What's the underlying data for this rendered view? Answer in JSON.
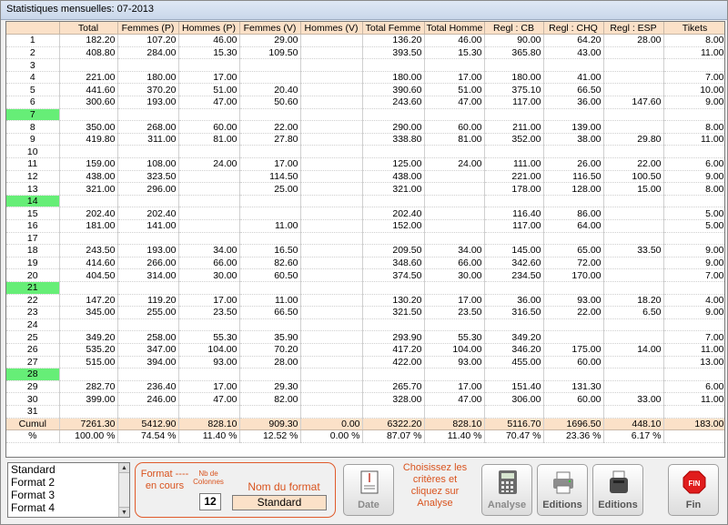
{
  "window": {
    "title": "Statistiques mensuelles: 07-2013"
  },
  "table": {
    "columns": [
      "",
      "Total",
      "Femmes (P)",
      "Hommes (P)",
      "Femmes (V)",
      "Hommes (V)",
      "Total Femme",
      "Total Homme",
      "Regl : CB",
      "Regl : CHQ",
      "Regl : ESP",
      "Tikets"
    ],
    "rows": [
      {
        "day": "1",
        "weekend": false,
        "cells": [
          "182.20",
          "107.20",
          "46.00",
          "29.00",
          "",
          "136.20",
          "46.00",
          "90.00",
          "64.20",
          "28.00",
          "8.00"
        ]
      },
      {
        "day": "2",
        "weekend": false,
        "cells": [
          "408.80",
          "284.00",
          "15.30",
          "109.50",
          "",
          "393.50",
          "15.30",
          "365.80",
          "43.00",
          "",
          "11.00"
        ]
      },
      {
        "day": "3",
        "weekend": false,
        "cells": [
          "",
          "",
          "",
          "",
          "",
          "",
          "",
          "",
          "",
          "",
          ""
        ]
      },
      {
        "day": "4",
        "weekend": false,
        "cells": [
          "221.00",
          "180.00",
          "17.00",
          "",
          "",
          "180.00",
          "17.00",
          "180.00",
          "41.00",
          "",
          "7.00"
        ]
      },
      {
        "day": "5",
        "weekend": false,
        "cells": [
          "441.60",
          "370.20",
          "51.00",
          "20.40",
          "",
          "390.60",
          "51.00",
          "375.10",
          "66.50",
          "",
          "10.00"
        ]
      },
      {
        "day": "6",
        "weekend": false,
        "cells": [
          "300.60",
          "193.00",
          "47.00",
          "50.60",
          "",
          "243.60",
          "47.00",
          "117.00",
          "36.00",
          "147.60",
          "9.00"
        ]
      },
      {
        "day": "7",
        "weekend": true,
        "cells": [
          "",
          "",
          "",
          "",
          "",
          "",
          "",
          "",
          "",
          "",
          ""
        ]
      },
      {
        "day": "8",
        "weekend": false,
        "cells": [
          "350.00",
          "268.00",
          "60.00",
          "22.00",
          "",
          "290.00",
          "60.00",
          "211.00",
          "139.00",
          "",
          "8.00"
        ]
      },
      {
        "day": "9",
        "weekend": false,
        "cells": [
          "419.80",
          "311.00",
          "81.00",
          "27.80",
          "",
          "338.80",
          "81.00",
          "352.00",
          "38.00",
          "29.80",
          "11.00"
        ]
      },
      {
        "day": "10",
        "weekend": false,
        "cells": [
          "",
          "",
          "",
          "",
          "",
          "",
          "",
          "",
          "",
          "",
          ""
        ]
      },
      {
        "day": "11",
        "weekend": false,
        "cells": [
          "159.00",
          "108.00",
          "24.00",
          "17.00",
          "",
          "125.00",
          "24.00",
          "111.00",
          "26.00",
          "22.00",
          "6.00"
        ]
      },
      {
        "day": "12",
        "weekend": false,
        "cells": [
          "438.00",
          "323.50",
          "",
          "114.50",
          "",
          "438.00",
          "",
          "221.00",
          "116.50",
          "100.50",
          "9.00"
        ]
      },
      {
        "day": "13",
        "weekend": false,
        "cells": [
          "321.00",
          "296.00",
          "",
          "25.00",
          "",
          "321.00",
          "",
          "178.00",
          "128.00",
          "15.00",
          "8.00"
        ]
      },
      {
        "day": "14",
        "weekend": true,
        "cells": [
          "",
          "",
          "",
          "",
          "",
          "",
          "",
          "",
          "",
          "",
          ""
        ]
      },
      {
        "day": "15",
        "weekend": false,
        "cells": [
          "202.40",
          "202.40",
          "",
          "",
          "",
          "202.40",
          "",
          "116.40",
          "86.00",
          "",
          "5.00"
        ]
      },
      {
        "day": "16",
        "weekend": false,
        "cells": [
          "181.00",
          "141.00",
          "",
          "11.00",
          "",
          "152.00",
          "",
          "117.00",
          "64.00",
          "",
          "5.00"
        ]
      },
      {
        "day": "17",
        "weekend": false,
        "cells": [
          "",
          "",
          "",
          "",
          "",
          "",
          "",
          "",
          "",
          "",
          ""
        ]
      },
      {
        "day": "18",
        "weekend": false,
        "cells": [
          "243.50",
          "193.00",
          "34.00",
          "16.50",
          "",
          "209.50",
          "34.00",
          "145.00",
          "65.00",
          "33.50",
          "9.00"
        ]
      },
      {
        "day": "19",
        "weekend": false,
        "cells": [
          "414.60",
          "266.00",
          "66.00",
          "82.60",
          "",
          "348.60",
          "66.00",
          "342.60",
          "72.00",
          "",
          "9.00"
        ]
      },
      {
        "day": "20",
        "weekend": false,
        "cells": [
          "404.50",
          "314.00",
          "30.00",
          "60.50",
          "",
          "374.50",
          "30.00",
          "234.50",
          "170.00",
          "",
          "7.00"
        ]
      },
      {
        "day": "21",
        "weekend": true,
        "cells": [
          "",
          "",
          "",
          "",
          "",
          "",
          "",
          "",
          "",
          "",
          ""
        ]
      },
      {
        "day": "22",
        "weekend": false,
        "cells": [
          "147.20",
          "119.20",
          "17.00",
          "11.00",
          "",
          "130.20",
          "17.00",
          "36.00",
          "93.00",
          "18.20",
          "4.00"
        ]
      },
      {
        "day": "23",
        "weekend": false,
        "cells": [
          "345.00",
          "255.00",
          "23.50",
          "66.50",
          "",
          "321.50",
          "23.50",
          "316.50",
          "22.00",
          "6.50",
          "9.00"
        ]
      },
      {
        "day": "24",
        "weekend": false,
        "cells": [
          "",
          "",
          "",
          "",
          "",
          "",
          "",
          "",
          "",
          "",
          ""
        ]
      },
      {
        "day": "25",
        "weekend": false,
        "cells": [
          "349.20",
          "258.00",
          "55.30",
          "35.90",
          "",
          "293.90",
          "55.30",
          "349.20",
          "",
          "",
          "7.00"
        ]
      },
      {
        "day": "26",
        "weekend": false,
        "cells": [
          "535.20",
          "347.00",
          "104.00",
          "70.20",
          "",
          "417.20",
          "104.00",
          "346.20",
          "175.00",
          "14.00",
          "11.00"
        ]
      },
      {
        "day": "27",
        "weekend": false,
        "cells": [
          "515.00",
          "394.00",
          "93.00",
          "28.00",
          "",
          "422.00",
          "93.00",
          "455.00",
          "60.00",
          "",
          "13.00"
        ]
      },
      {
        "day": "28",
        "weekend": true,
        "cells": [
          "",
          "",
          "",
          "",
          "",
          "",
          "",
          "",
          "",
          "",
          ""
        ]
      },
      {
        "day": "29",
        "weekend": false,
        "cells": [
          "282.70",
          "236.40",
          "17.00",
          "29.30",
          "",
          "265.70",
          "17.00",
          "151.40",
          "131.30",
          "",
          "6.00"
        ]
      },
      {
        "day": "30",
        "weekend": false,
        "cells": [
          "399.00",
          "246.00",
          "47.00",
          "82.00",
          "",
          "328.00",
          "47.00",
          "306.00",
          "60.00",
          "33.00",
          "11.00"
        ]
      },
      {
        "day": "31",
        "weekend": false,
        "cells": [
          "",
          "",
          "",
          "",
          "",
          "",
          "",
          "",
          "",
          "",
          ""
        ]
      }
    ],
    "cumul": {
      "label": "Cumul",
      "cells": [
        "7261.30",
        "5412.90",
        "828.10",
        "909.30",
        "0.00",
        "6322.20",
        "828.10",
        "5116.70",
        "1696.50",
        "448.10",
        "183.00"
      ]
    },
    "percent": {
      "label": "%",
      "cells": [
        "100.00 %",
        "74.54 %",
        "11.40 %",
        "12.52 %",
        "0.00 %",
        "87.07 %",
        "11.40 %",
        "70.47 %",
        "23.36 %",
        "6.17 %",
        ""
      ]
    }
  },
  "formats": {
    "items": [
      "Standard",
      "Format  2",
      "Format  3",
      "Format  4"
    ],
    "current_label": "Format ---- en cours",
    "nb_label": "Nb de Colonnes",
    "nb_value": "12",
    "name_label": "Nom du format",
    "name_value": "Standard"
  },
  "toolbar": {
    "date": "Date",
    "hint": "Choisissez les critères et cliquez sur Analyse",
    "analyse": "Analyse",
    "editions1": "Editions",
    "editions2": "Editions",
    "fin": "Fin",
    "fin_badge": "FIN"
  },
  "colors": {
    "header": "#fbe1c8",
    "weekend": "#66ee77",
    "accent": "#d9531e",
    "fin": "#e01d1d"
  }
}
